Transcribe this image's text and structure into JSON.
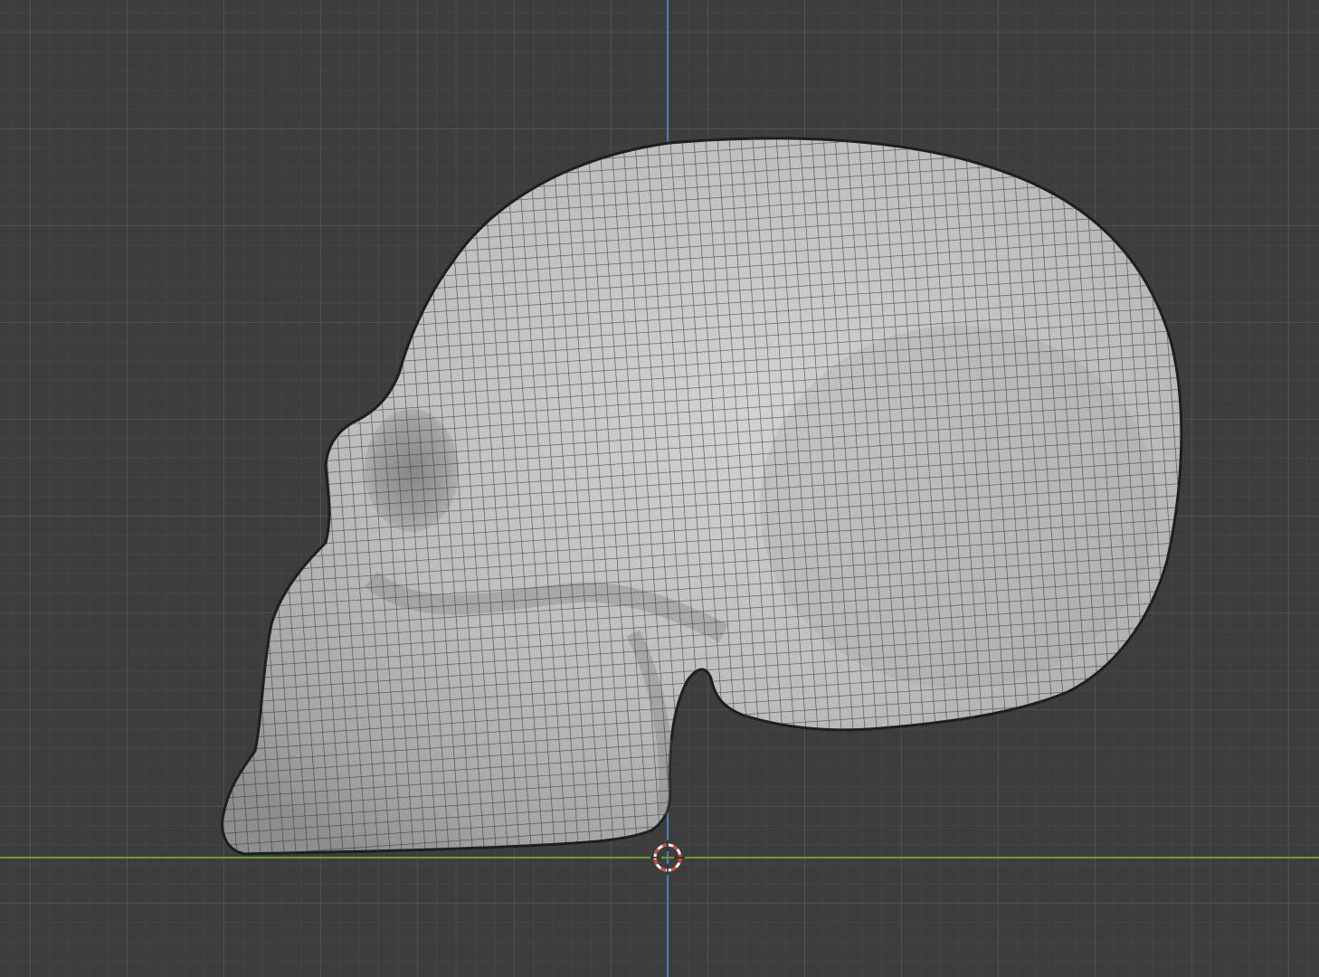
{
  "viewport": {
    "view": "side",
    "background_color": "#3d3d3d",
    "grid_major_color": "#5a5a5a",
    "grid_minor_color": "#484848",
    "axis_z_color": "#4f7bb3",
    "axis_y_color": "#6f9a3b"
  },
  "object": {
    "name": "skull-mesh",
    "display": "wireframe-overlay",
    "surface_color": "#bdbdbd",
    "wire_color": "#2b2b2b"
  },
  "cursor_3d": {
    "icon": "3d-cursor-icon",
    "ring_color_a": "#d8453d",
    "ring_color_b": "#ffffff"
  }
}
